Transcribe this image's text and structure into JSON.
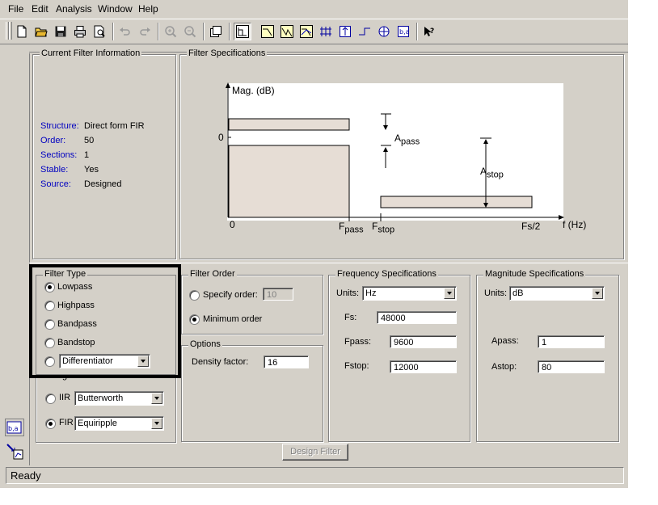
{
  "menu": [
    "File",
    "Edit",
    "Analysis",
    "Window",
    "Help"
  ],
  "toolbar": {
    "icons": [
      "new-document-icon",
      "open-folder-icon",
      "save-icon",
      "print-icon",
      "print-preview-icon",
      "undo-icon",
      "redo-icon",
      "zoom-in-icon",
      "zoom-out-icon",
      "copy-window-icon",
      "filter-specs-icon",
      "magnitude-response-icon",
      "phase-response-icon",
      "magnitude-phase-icon",
      "group-delay-icon",
      "impulse-response-icon",
      "step-response-icon",
      "pole-zero-icon",
      "filter-coefficients-icon",
      "whats-this-help-icon"
    ]
  },
  "current_info": {
    "title": "Current Filter Information",
    "rows": [
      {
        "label": "Structure:",
        "value": "Direct form FIR"
      },
      {
        "label": "Order:",
        "value": "50"
      },
      {
        "label": "Sections:",
        "value": "1"
      },
      {
        "label": "Stable:",
        "value": "Yes"
      },
      {
        "label": "Source:",
        "value": "Designed"
      }
    ]
  },
  "specs_plot": {
    "title": "Filter Specifications",
    "ylabel": "Mag. (dB)",
    "zero_y": "0",
    "zero_x": "0",
    "apass": {
      "main": "A",
      "sub": "pass"
    },
    "astop": {
      "main": "A",
      "sub": "stop"
    },
    "fpass": {
      "main": "F",
      "sub": "pass"
    },
    "fstop": {
      "main": "F",
      "sub": "stop"
    },
    "fs2": "Fs/2",
    "xlabel": "f (Hz)",
    "colors": {
      "band_fill": "#e6ddd5"
    }
  },
  "filter_type": {
    "title": "Filter Type",
    "options": [
      "Lowpass",
      "Highpass",
      "Bandpass",
      "Bandstop"
    ],
    "selected": 0,
    "other_select": "Differentiator"
  },
  "design_method": {
    "title": "Design Method",
    "iir_label": "IIR",
    "iir_select": "Butterworth",
    "fir_label": "FIR",
    "fir_select": "Equiripple",
    "selected": "FIR"
  },
  "filter_order": {
    "title": "Filter Order",
    "specify_label": "Specify order:",
    "specify_value": "10",
    "minimum_label": "Minimum order",
    "selected": "minimum"
  },
  "options": {
    "title": "Options",
    "density_label": "Density factor:",
    "density_value": "16"
  },
  "freq_specs": {
    "title": "Frequency Specifications",
    "units_label": "Units:",
    "units_value": "Hz",
    "fs_label": "Fs:",
    "fs_value": "48000",
    "fpass_label": "Fpass:",
    "fpass_value": "9600",
    "fstop_label": "Fstop:",
    "fstop_value": "12000"
  },
  "mag_specs": {
    "title": "Magnitude Specifications",
    "units_label": "Units:",
    "units_value": "dB",
    "apass_label": "Apass:",
    "apass_value": "1",
    "astop_label": "Astop:",
    "astop_value": "80"
  },
  "design_button": "Design Filter",
  "status": "Ready"
}
